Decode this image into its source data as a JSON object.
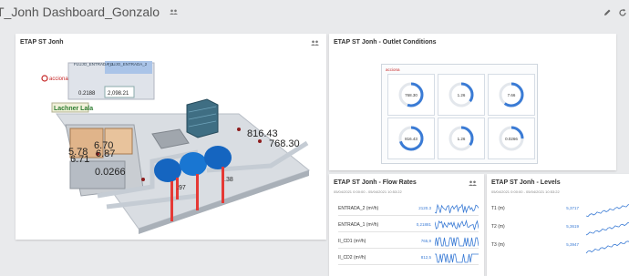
{
  "header": {
    "title": "T_Jonh Dashboard_Gonzalo"
  },
  "panels": {
    "scada": {
      "title": "ETAP ST Jonh",
      "tag1": "FLUJO_ENTRADA_1",
      "tag2": "FLUJO_ENTRADA_2",
      "flow1": "0.2188",
      "flow2": "2,098.21",
      "logo": "acciona",
      "sign": "Lachner Lala",
      "v1": "5.78",
      "v2": "6.70",
      "v3": "6.71",
      "v4": "6.87",
      "v5": "0.0266",
      "v6": "816.43",
      "v7": "768.30",
      "v8": ".97",
      "v9": ".38"
    },
    "outlet": {
      "title": "ETAP ST Jonh - Outlet Conditions",
      "logo": "acciona",
      "gauges": [
        "768.30",
        "1.26",
        "7.66",
        "816.43",
        "1.26",
        "0.0266"
      ]
    },
    "flow": {
      "title": "ETAP ST Jonh - Flow Rates",
      "range": "05/04/2021 0:00:00 - 05/04/2021 10:53:22",
      "rows": [
        {
          "label": "ENTRADA_2 (m³/h)",
          "value": "2120.3"
        },
        {
          "label": "ENTRADA_1 (m³/h)",
          "value": "0,21881"
        },
        {
          "label": "II_CD1 (m³/h)",
          "value": "765,9"
        },
        {
          "label": "II_CD2 (m³/h)",
          "value": "812,5"
        }
      ]
    },
    "levels": {
      "title": "ETAP ST Jonh - Levels",
      "range": "05/04/2021 0:00:00 - 05/04/2021 10:53:22",
      "rows": [
        {
          "label": "T1 (m)",
          "value": "5,3717"
        },
        {
          "label": "T2 (m)",
          "value": "5,3619"
        },
        {
          "label": "T3 (m)",
          "value": "5,3947"
        }
      ]
    }
  },
  "colors": {
    "accent": "#3a7bd5",
    "tank": "#1565c0",
    "pillar": "#e53935",
    "brand": "#c62828"
  }
}
